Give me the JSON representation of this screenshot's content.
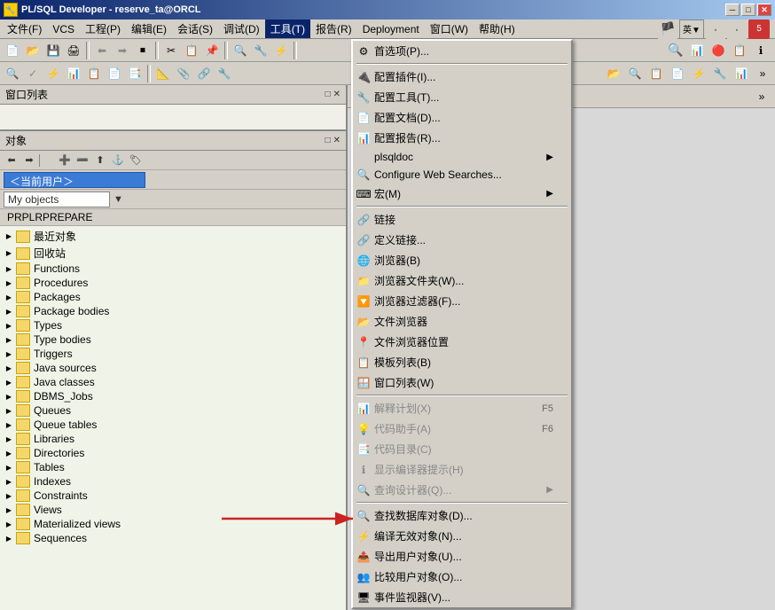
{
  "window": {
    "title": "PL/SQL Developer - reserve_ta@ORCL",
    "icon": "🔧"
  },
  "titlebar": {
    "minimize": "─",
    "maximize": "□",
    "close": "✕"
  },
  "menubar": {
    "items": [
      {
        "label": "文件(F)"
      },
      {
        "label": "VCS"
      },
      {
        "label": "工程(P)"
      },
      {
        "label": "编辑(E)"
      },
      {
        "label": "会话(S)"
      },
      {
        "label": "调试(D)"
      },
      {
        "label": "工具(T)",
        "active": true
      },
      {
        "label": "报告(R)"
      },
      {
        "label": "Deployment"
      },
      {
        "label": "窗口(W)"
      },
      {
        "label": "帮助(H)"
      }
    ]
  },
  "toolbar1": {
    "buttons": [
      "📄",
      "📂",
      "💾",
      "🖨",
      "📑",
      "⬅",
      "➡",
      "⏹",
      "✂",
      "📋",
      "📌",
      "🔍",
      "🔧",
      "⚡"
    ]
  },
  "toolbar2": {
    "buttons": [
      "🔍",
      "✓",
      "❌",
      "📊",
      "📋",
      "📄",
      "🖊",
      "📐",
      "📎",
      "🔗",
      "🔧"
    ]
  },
  "panels": {
    "window_list": {
      "title": "窗口列表"
    },
    "object": {
      "title": "对象",
      "schema": "＜当前用户＞",
      "filter": "My objects",
      "owner": "PRPLRPREPARE"
    }
  },
  "tree": {
    "items": [
      {
        "label": "最近对象",
        "indent": 0,
        "expanded": false
      },
      {
        "label": "回收站",
        "indent": 0,
        "expanded": false
      },
      {
        "label": "Functions",
        "indent": 0,
        "expanded": false
      },
      {
        "label": "Procedures",
        "indent": 0,
        "expanded": false
      },
      {
        "label": "Packages",
        "indent": 0,
        "expanded": false
      },
      {
        "label": "Package bodies",
        "indent": 0,
        "expanded": false
      },
      {
        "label": "Types",
        "indent": 0,
        "expanded": false
      },
      {
        "label": "Type bodies",
        "indent": 0,
        "expanded": false
      },
      {
        "label": "Triggers",
        "indent": 0,
        "expanded": false
      },
      {
        "label": "Java sources",
        "indent": 0,
        "expanded": false
      },
      {
        "label": "Java classes",
        "indent": 0,
        "expanded": false
      },
      {
        "label": "DBMS_Jobs",
        "indent": 0,
        "expanded": false
      },
      {
        "label": "Queues",
        "indent": 0,
        "expanded": false
      },
      {
        "label": "Queue tables",
        "indent": 0,
        "expanded": false
      },
      {
        "label": "Libraries",
        "indent": 0,
        "expanded": false
      },
      {
        "label": "Directories",
        "indent": 0,
        "expanded": false
      },
      {
        "label": "Tables",
        "indent": 0,
        "expanded": false
      },
      {
        "label": "Indexes",
        "indent": 0,
        "expanded": false
      },
      {
        "label": "Constraints",
        "indent": 0,
        "expanded": false
      },
      {
        "label": "Views",
        "indent": 0,
        "expanded": false
      },
      {
        "label": "Materialized views",
        "indent": 0,
        "expanded": false
      },
      {
        "label": "Sequences",
        "indent": 0,
        "expanded": false
      }
    ]
  },
  "dropdown": {
    "items": [
      {
        "type": "item",
        "icon": "⚙",
        "label": "首选项(P)...",
        "shortcut": "",
        "submenu": false,
        "disabled": false
      },
      {
        "type": "sep"
      },
      {
        "type": "item",
        "icon": "🔌",
        "label": "配置插件(I)...",
        "shortcut": "",
        "disabled": false
      },
      {
        "type": "item",
        "icon": "🔧",
        "label": "配置工具(T)...",
        "shortcut": "",
        "disabled": false
      },
      {
        "type": "item",
        "icon": "📄",
        "label": "配置文档(D)...",
        "shortcut": "",
        "disabled": false
      },
      {
        "type": "item",
        "icon": "📊",
        "label": "配置报告(R)...",
        "shortcut": "",
        "disabled": false
      },
      {
        "type": "item",
        "icon": "",
        "label": "plsqldoc",
        "shortcut": "",
        "submenu": true,
        "disabled": false
      },
      {
        "type": "item",
        "icon": "🔍",
        "label": "Configure Web Searches...",
        "shortcut": "",
        "disabled": false
      },
      {
        "type": "item",
        "icon": "⌨",
        "label": "宏(M)",
        "shortcut": "",
        "submenu": true,
        "disabled": false
      },
      {
        "type": "sep"
      },
      {
        "type": "item",
        "icon": "🔗",
        "label": "链接",
        "shortcut": "",
        "disabled": false
      },
      {
        "type": "item",
        "icon": "🔗",
        "label": "定义链接...",
        "shortcut": "",
        "disabled": false
      },
      {
        "type": "item",
        "icon": "🌐",
        "label": "浏览器(B)",
        "shortcut": "",
        "disabled": false
      },
      {
        "type": "item",
        "icon": "📁",
        "label": "浏览器文件夹(W)...",
        "shortcut": "",
        "disabled": false
      },
      {
        "type": "item",
        "icon": "🔽",
        "label": "浏览器过滤器(F)...",
        "shortcut": "",
        "disabled": false
      },
      {
        "type": "item",
        "icon": "📂",
        "label": "文件浏览器",
        "shortcut": "",
        "disabled": false
      },
      {
        "type": "item",
        "icon": "📍",
        "label": "文件浏览器位置",
        "shortcut": "",
        "disabled": false
      },
      {
        "type": "item",
        "icon": "📋",
        "label": "模板列表(B)",
        "shortcut": "",
        "disabled": false
      },
      {
        "type": "item",
        "icon": "🪟",
        "label": "窗口列表(W)",
        "shortcut": "",
        "disabled": false
      },
      {
        "type": "sep"
      },
      {
        "type": "item",
        "icon": "📊",
        "label": "解释计划(X)",
        "shortcut": "F5",
        "disabled": true
      },
      {
        "type": "item",
        "icon": "💡",
        "label": "代码助手(A)",
        "shortcut": "F6",
        "disabled": true
      },
      {
        "type": "item",
        "icon": "📑",
        "label": "代码目录(C)",
        "shortcut": "",
        "disabled": true
      },
      {
        "type": "item",
        "icon": "ℹ",
        "label": "显示编译器提示(H)",
        "shortcut": "",
        "disabled": true
      },
      {
        "type": "item",
        "icon": "🔍",
        "label": "查询设计器(Q)...",
        "shortcut": "",
        "submenu": true,
        "disabled": true
      },
      {
        "type": "sep"
      },
      {
        "type": "item",
        "icon": "🔍",
        "label": "查找数据库对象(D)...",
        "shortcut": "",
        "disabled": false
      },
      {
        "type": "item",
        "icon": "⚡",
        "label": "编译无效对象(N)...",
        "shortcut": "",
        "disabled": false
      },
      {
        "type": "item",
        "icon": "📤",
        "label": "导出用户对象(U)...",
        "shortcut": "",
        "disabled": false
      },
      {
        "type": "item",
        "icon": "👥",
        "label": "比较用户对象(O)...",
        "shortcut": "",
        "disabled": false
      },
      {
        "type": "item",
        "icon": "🖥",
        "label": "事件监视器(V)...",
        "shortcut": "",
        "disabled": false
      }
    ]
  }
}
